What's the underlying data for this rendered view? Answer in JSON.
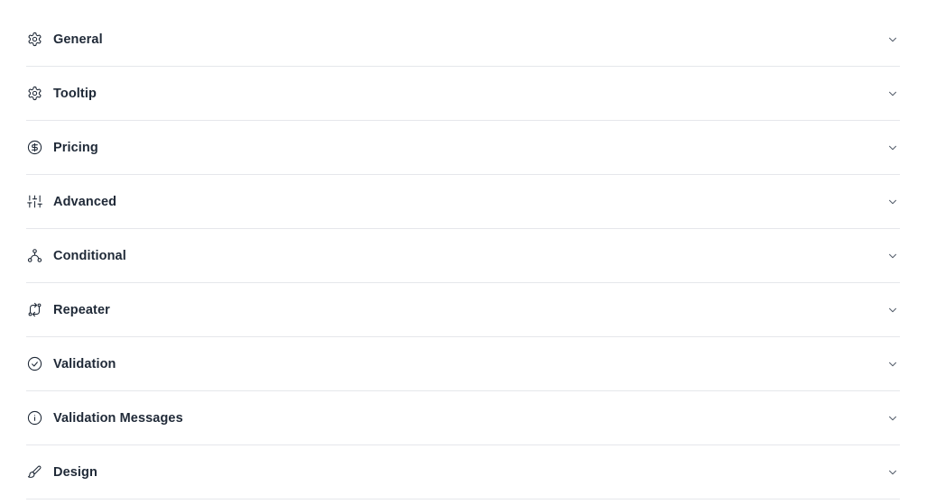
{
  "sections": [
    {
      "label": "General",
      "icon": "gear-icon"
    },
    {
      "label": "Tooltip",
      "icon": "gear-icon"
    },
    {
      "label": "Pricing",
      "icon": "dollar-circle-icon"
    },
    {
      "label": "Advanced",
      "icon": "sliders-icon"
    },
    {
      "label": "Conditional",
      "icon": "network-icon"
    },
    {
      "label": "Repeater",
      "icon": "repeat-icon"
    },
    {
      "label": "Validation",
      "icon": "check-circle-icon"
    },
    {
      "label": "Validation Messages",
      "icon": "info-circle-icon"
    },
    {
      "label": "Design",
      "icon": "brush-icon"
    }
  ]
}
